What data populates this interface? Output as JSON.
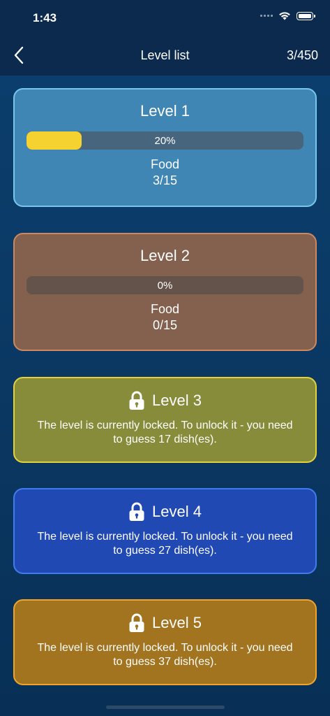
{
  "status": {
    "time": "1:43"
  },
  "nav": {
    "title": "Level list",
    "count": "3/450"
  },
  "levels": [
    {
      "title": "Level 1",
      "progress_text": "20%",
      "progress": 0.2,
      "category": "Food",
      "count": "3/15",
      "colors": {
        "bg": "#3f86b5",
        "border": "#78c6ee",
        "track": "#47657c"
      }
    },
    {
      "title": "Level 2",
      "progress_text": "0%",
      "progress": 0.0,
      "category": "Food",
      "count": "0/15",
      "colors": {
        "bg": "#83614e",
        "border": "#d0875c",
        "track": "#64534a"
      }
    },
    {
      "title": "Level 3",
      "locked_message": "The level is currently locked. To unlock it - you need to guess 17 dish(es).",
      "colors": {
        "bg": "#868c3a",
        "border": "#e6d23a"
      }
    },
    {
      "title": "Level 4",
      "locked_message": "The level is currently locked. To unlock it - you need to guess 27 dish(es).",
      "colors": {
        "bg": "#2149b4",
        "border": "#3f7cf0"
      }
    },
    {
      "title": "Level 5",
      "locked_message": "The level is currently locked. To unlock it - you need to guess 37 dish(es).",
      "colors": {
        "bg": "#a3741f",
        "border": "#f0a52a"
      }
    }
  ],
  "icons": {
    "back": "chevron-left-icon",
    "lock": "lock-icon",
    "wifi": "wifi-icon",
    "battery": "battery-icon"
  }
}
